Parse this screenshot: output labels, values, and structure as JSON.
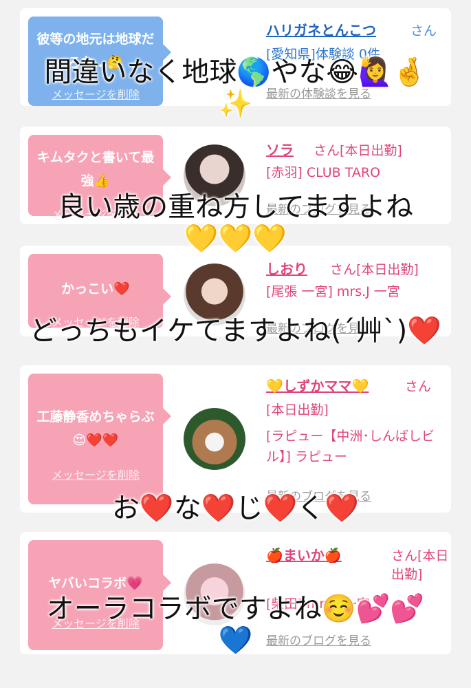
{
  "cards": [
    {
      "bubble_text": "彼等の地元は地球だろな…🤔",
      "delete_label": "メッセージを削除",
      "name": "ハリガネとんこつ",
      "suffix": "さん",
      "info_1": "[愛知県]体験談 0件",
      "info_2": "",
      "latest_label": "最新の体験談を見る"
    },
    {
      "bubble_text": "キムタクと書いて最強👍",
      "delete_label": "メッセージを削除",
      "name": "ソラ",
      "suffix": "さん[本日出勤]",
      "info_1": "[赤羽] CLUB TARO",
      "info_2": "",
      "latest_label": "最新のブログを見る"
    },
    {
      "bubble_text": "かっこい❤️",
      "delete_label": "メッセージを削除",
      "name": "しおり",
      "suffix": "さん[本日出勤]",
      "info_1": "[尾張 一宮] mrs.J 一宮",
      "info_2": "",
      "latest_label": "最新のブログを見る"
    },
    {
      "bubble_text": "工藤静香めちゃらぶ😍❤️❤️",
      "delete_label": "メッセージを削除",
      "name": "💛しずかママ💛",
      "suffix": "さん",
      "info_1": "[本日出勤]",
      "info_2": "[ラピュー【中洲･しんばしビル】] ラピュー",
      "latest_label": "最新のブログを見る"
    },
    {
      "bubble_text": "ヤバいコラボ💗",
      "delete_label": "メッセージを削除",
      "name": "🍎まいか🍎",
      "suffix": "さん[本日出勤]",
      "info_1": "[柴田] mrs.J 一宮",
      "info_2": "",
      "latest_label": "最新のブログを見る"
    }
  ],
  "overlay_captions": [
    "間違いなく地球🌎やな😂🙋‍♀️🤞\n✨",
    "良い歳の重ね方してますよね\n💛💛💛",
    "どっちもイケてますよね(´艸`)❤️",
    "お❤️な❤️じ❤️く❤️",
    "オーラコラボですよね☺️💕💕\n💙"
  ],
  "colors": {
    "page_bg": "#f2f2f2",
    "bubble_blue": "#7fb2ec",
    "bubble_pink": "#f7a3b6",
    "name_blue": "#1f63c0",
    "name_pink": "#e0457a",
    "link_gray": "#9a9a9a"
  },
  "avatars": [
    "blurred-woman-photo",
    "woman-photo",
    "woman-mask-photo",
    "blurred-woman-photo"
  ]
}
